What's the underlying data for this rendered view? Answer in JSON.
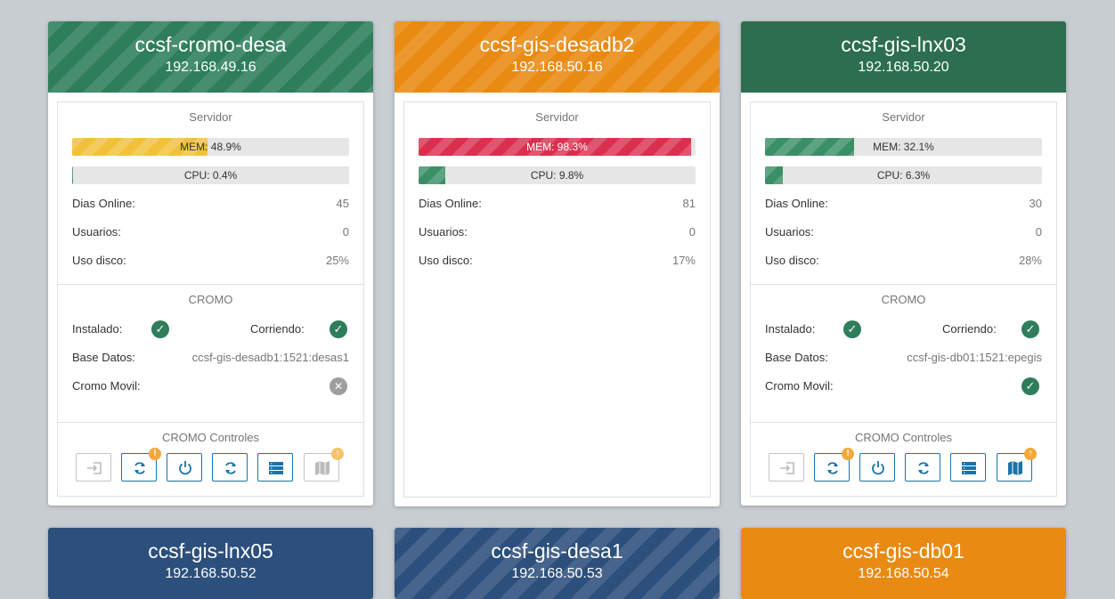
{
  "colors": {
    "green": "#2e7d5b",
    "orange": "#e98a12",
    "blue": "#2c4f7c",
    "mem_yellow": "#f2c13b",
    "mem_red": "#d9304f",
    "bar_green": "#3a8f67"
  },
  "servers": [
    {
      "name": "ccsf-cromo-desa",
      "ip": "192.168.49.16",
      "servidor_label": "Servidor",
      "mem_label": "MEM: 48.9%",
      "mem_percent": 48.9,
      "cpu_label": "CPU: 0.4%",
      "cpu_percent": 0.4,
      "dias_label": "Dias Online:",
      "dias_value": "45",
      "usuarios_label": "Usuarios:",
      "usuarios_value": "0",
      "disco_label": "Uso disco:",
      "disco_value": "25%",
      "cromo_title": "CROMO",
      "instalado_label": "Instalado:",
      "corriendo_label": "Corriendo:",
      "base_label": "Base Datos:",
      "base_value": "ccsf-gis-desadb1:1521:desas1",
      "movil_label": "Cromo Movil:",
      "controles_title": "CROMO Controles"
    },
    {
      "name": "ccsf-gis-desadb2",
      "ip": "192.168.50.16",
      "servidor_label": "Servidor",
      "mem_label": "MEM: 98.3%",
      "mem_percent": 98.3,
      "cpu_label": "CPU: 9.8%",
      "cpu_percent": 9.8,
      "dias_label": "Dias Online:",
      "dias_value": "81",
      "usuarios_label": "Usuarios:",
      "usuarios_value": "0",
      "disco_label": "Uso disco:",
      "disco_value": "17%"
    },
    {
      "name": "ccsf-gis-lnx03",
      "ip": "192.168.50.20",
      "servidor_label": "Servidor",
      "mem_label": "MEM: 32.1%",
      "mem_percent": 32.1,
      "cpu_label": "CPU: 6.3%",
      "cpu_percent": 6.3,
      "dias_label": "Dias Online:",
      "dias_value": "30",
      "usuarios_label": "Usuarios:",
      "usuarios_value": "0",
      "disco_label": "Uso disco:",
      "disco_value": "28%",
      "cromo_title": "CROMO",
      "instalado_label": "Instalado:",
      "corriendo_label": "Corriendo:",
      "base_label": "Base Datos:",
      "base_value": "ccsf-gis-db01:1521:epegis",
      "movil_label": "Cromo Movil:",
      "controles_title": "CROMO Controles"
    },
    {
      "name": "ccsf-gis-lnx05",
      "ip": "192.168.50.52"
    },
    {
      "name": "ccsf-gis-desa1",
      "ip": "192.168.50.53"
    },
    {
      "name": "ccsf-gis-db01",
      "ip": "192.168.50.54"
    }
  ],
  "badges": {
    "warning": "!",
    "upload": "↑"
  },
  "status_icons": {
    "ok": "✓",
    "fail": "✕"
  },
  "controls_icons": [
    "login-icon",
    "sync-warning-icon",
    "power-icon",
    "refresh-icon",
    "server-list-icon",
    "map-icon"
  ]
}
